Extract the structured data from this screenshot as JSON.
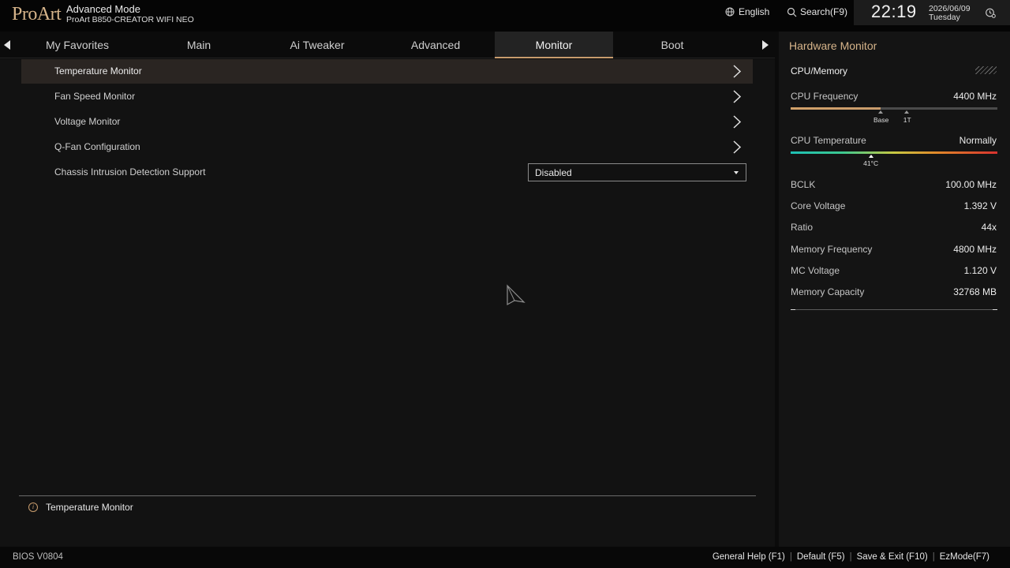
{
  "header": {
    "logo": "ProArt",
    "mode": "Advanced Mode",
    "board": "ProArt B850-CREATOR WIFI NEO",
    "language": "English",
    "search": "Search(F9)",
    "time": "22:19",
    "date": "2026/06/09",
    "day": "Tuesday"
  },
  "tabs": [
    {
      "label": "My Favorites"
    },
    {
      "label": "Main"
    },
    {
      "label": "Ai Tweaker"
    },
    {
      "label": "Advanced"
    },
    {
      "label": "Monitor"
    },
    {
      "label": "Boot"
    }
  ],
  "active_tab": "Monitor",
  "menu": {
    "items": [
      {
        "label": "Temperature Monitor"
      },
      {
        "label": "Fan Speed Monitor"
      },
      {
        "label": "Voltage Monitor"
      },
      {
        "label": "Q-Fan Configuration"
      }
    ],
    "chassis": {
      "label": "Chassis Intrusion Detection Support",
      "value": "Disabled"
    }
  },
  "help": {
    "text": "Temperature Monitor"
  },
  "hw_monitor": {
    "title": "Hardware Monitor",
    "section": "CPU/Memory",
    "cpu_frequency": {
      "label": "CPU Frequency",
      "value": "4400 MHz",
      "fill_fraction": 0.435,
      "base_label": "Base",
      "base_fraction": 0.435,
      "t1_label": "1T",
      "t1_fraction": 0.56
    },
    "cpu_temperature": {
      "label": "CPU Temperature",
      "value": "Normally",
      "marker_label": "41°C",
      "marker_fraction": 0.39
    },
    "stats": [
      {
        "label": "BCLK",
        "value": "100.00 MHz"
      },
      {
        "label": "Core Voltage",
        "value": "1.392 V"
      },
      {
        "label": "Ratio",
        "value": "44x"
      },
      {
        "label": "Memory Frequency",
        "value": "4800 MHz"
      },
      {
        "label": "MC Voltage",
        "value": "1.120 V"
      },
      {
        "label": "Memory Capacity",
        "value": "32768 MB"
      }
    ]
  },
  "footer": {
    "bios_version": "BIOS V0804",
    "links": [
      "General Help (F1)",
      "Default (F5)",
      "Save & Exit (F10)",
      "EzMode(F7)"
    ]
  },
  "colors": {
    "accent": "#c89c6d",
    "brand": "#d6b48a"
  }
}
